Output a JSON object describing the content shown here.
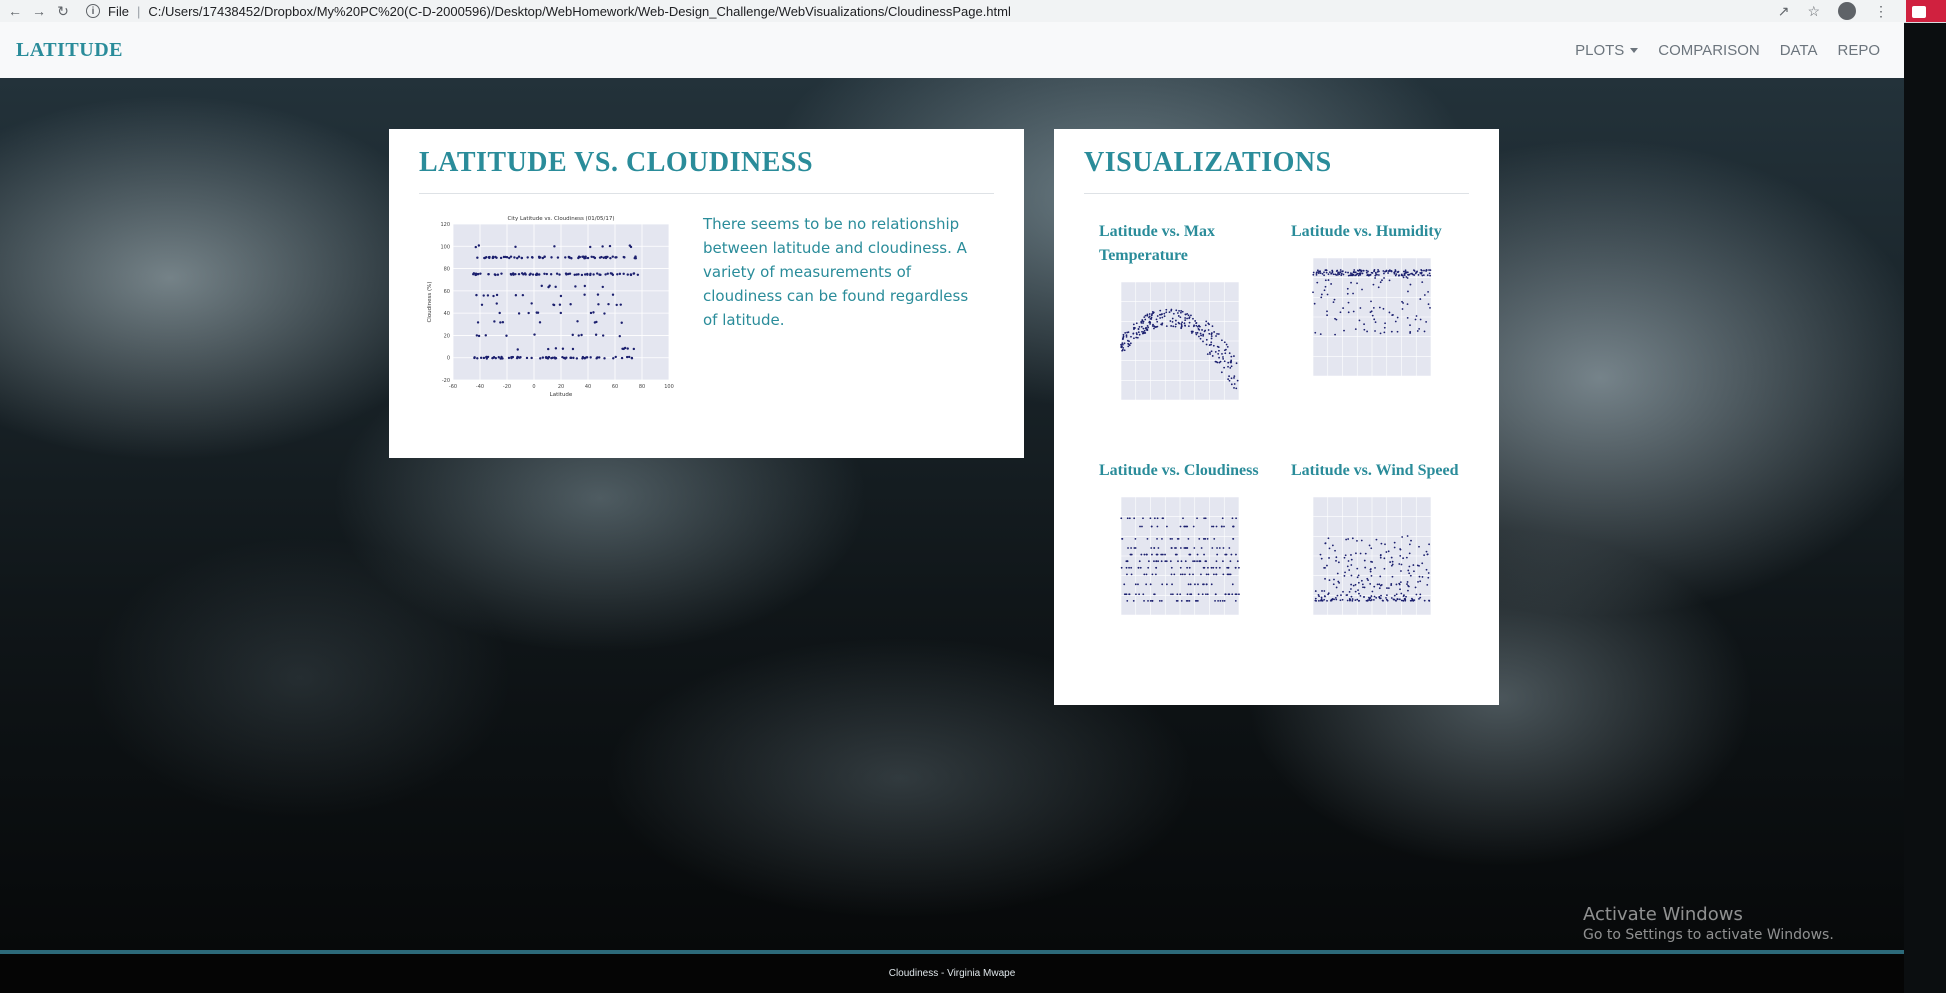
{
  "browser": {
    "file_label": "File",
    "url": "C:/Users/17438452/Dropbox/My%20PC%20(C-D-2000596)/Desktop/WebHomework/Web-Design_Challenge/WebVisualizations/CloudinessPage.html"
  },
  "navbar": {
    "brand": "LATITUDE",
    "links": [
      "PLOTS",
      "COMPARISON",
      "DATA",
      "REPO"
    ]
  },
  "main": {
    "title": "LATITUDE VS. CLOUDINESS",
    "description": "There seems to be no relationship between latitude and cloudiness. A variety of measurements of cloudiness can be found regardless of latitude.",
    "plot": {
      "title": "City Latitude vs. Cloudiness (01/05/17)",
      "xlabel": "Latitude",
      "ylabel": "Cloudiness (%)",
      "xticks": [
        "-60",
        "-40",
        "-20",
        "0",
        "20",
        "40",
        "60",
        "80",
        "100"
      ],
      "yticks": [
        "-20",
        "0",
        "20",
        "40",
        "60",
        "80",
        "100",
        "120"
      ]
    }
  },
  "visualizations": {
    "title": "VISUALIZATIONS",
    "items": [
      {
        "title": "Latitude vs. Max Temperature"
      },
      {
        "title": "Latitude vs. Humidity"
      },
      {
        "title": "Latitude vs. Cloudiness"
      },
      {
        "title": "Latitude vs. Wind Speed"
      }
    ]
  },
  "footer": {
    "text": "Cloudiness - Virginia Mwape"
  },
  "watermark": {
    "line1": "Activate Windows",
    "line2": "Go to Settings to activate Windows."
  },
  "chart_data": {
    "type": "scatter",
    "title": "City Latitude vs. Cloudiness (01/05/17)",
    "xlabel": "Latitude",
    "ylabel": "Cloudiness (%)",
    "xlim": [
      -60,
      100
    ],
    "ylim": [
      -20,
      120
    ],
    "grid": true,
    "cloudiness_levels": [
      0,
      8,
      20,
      32,
      40,
      48,
      56,
      64,
      75,
      90,
      100
    ],
    "latitude_range": [
      -45,
      78
    ]
  },
  "colors": {
    "accent": "#2a8c9a",
    "marker": "#1b1f6e",
    "plot_bg": "#e4e6f0"
  }
}
